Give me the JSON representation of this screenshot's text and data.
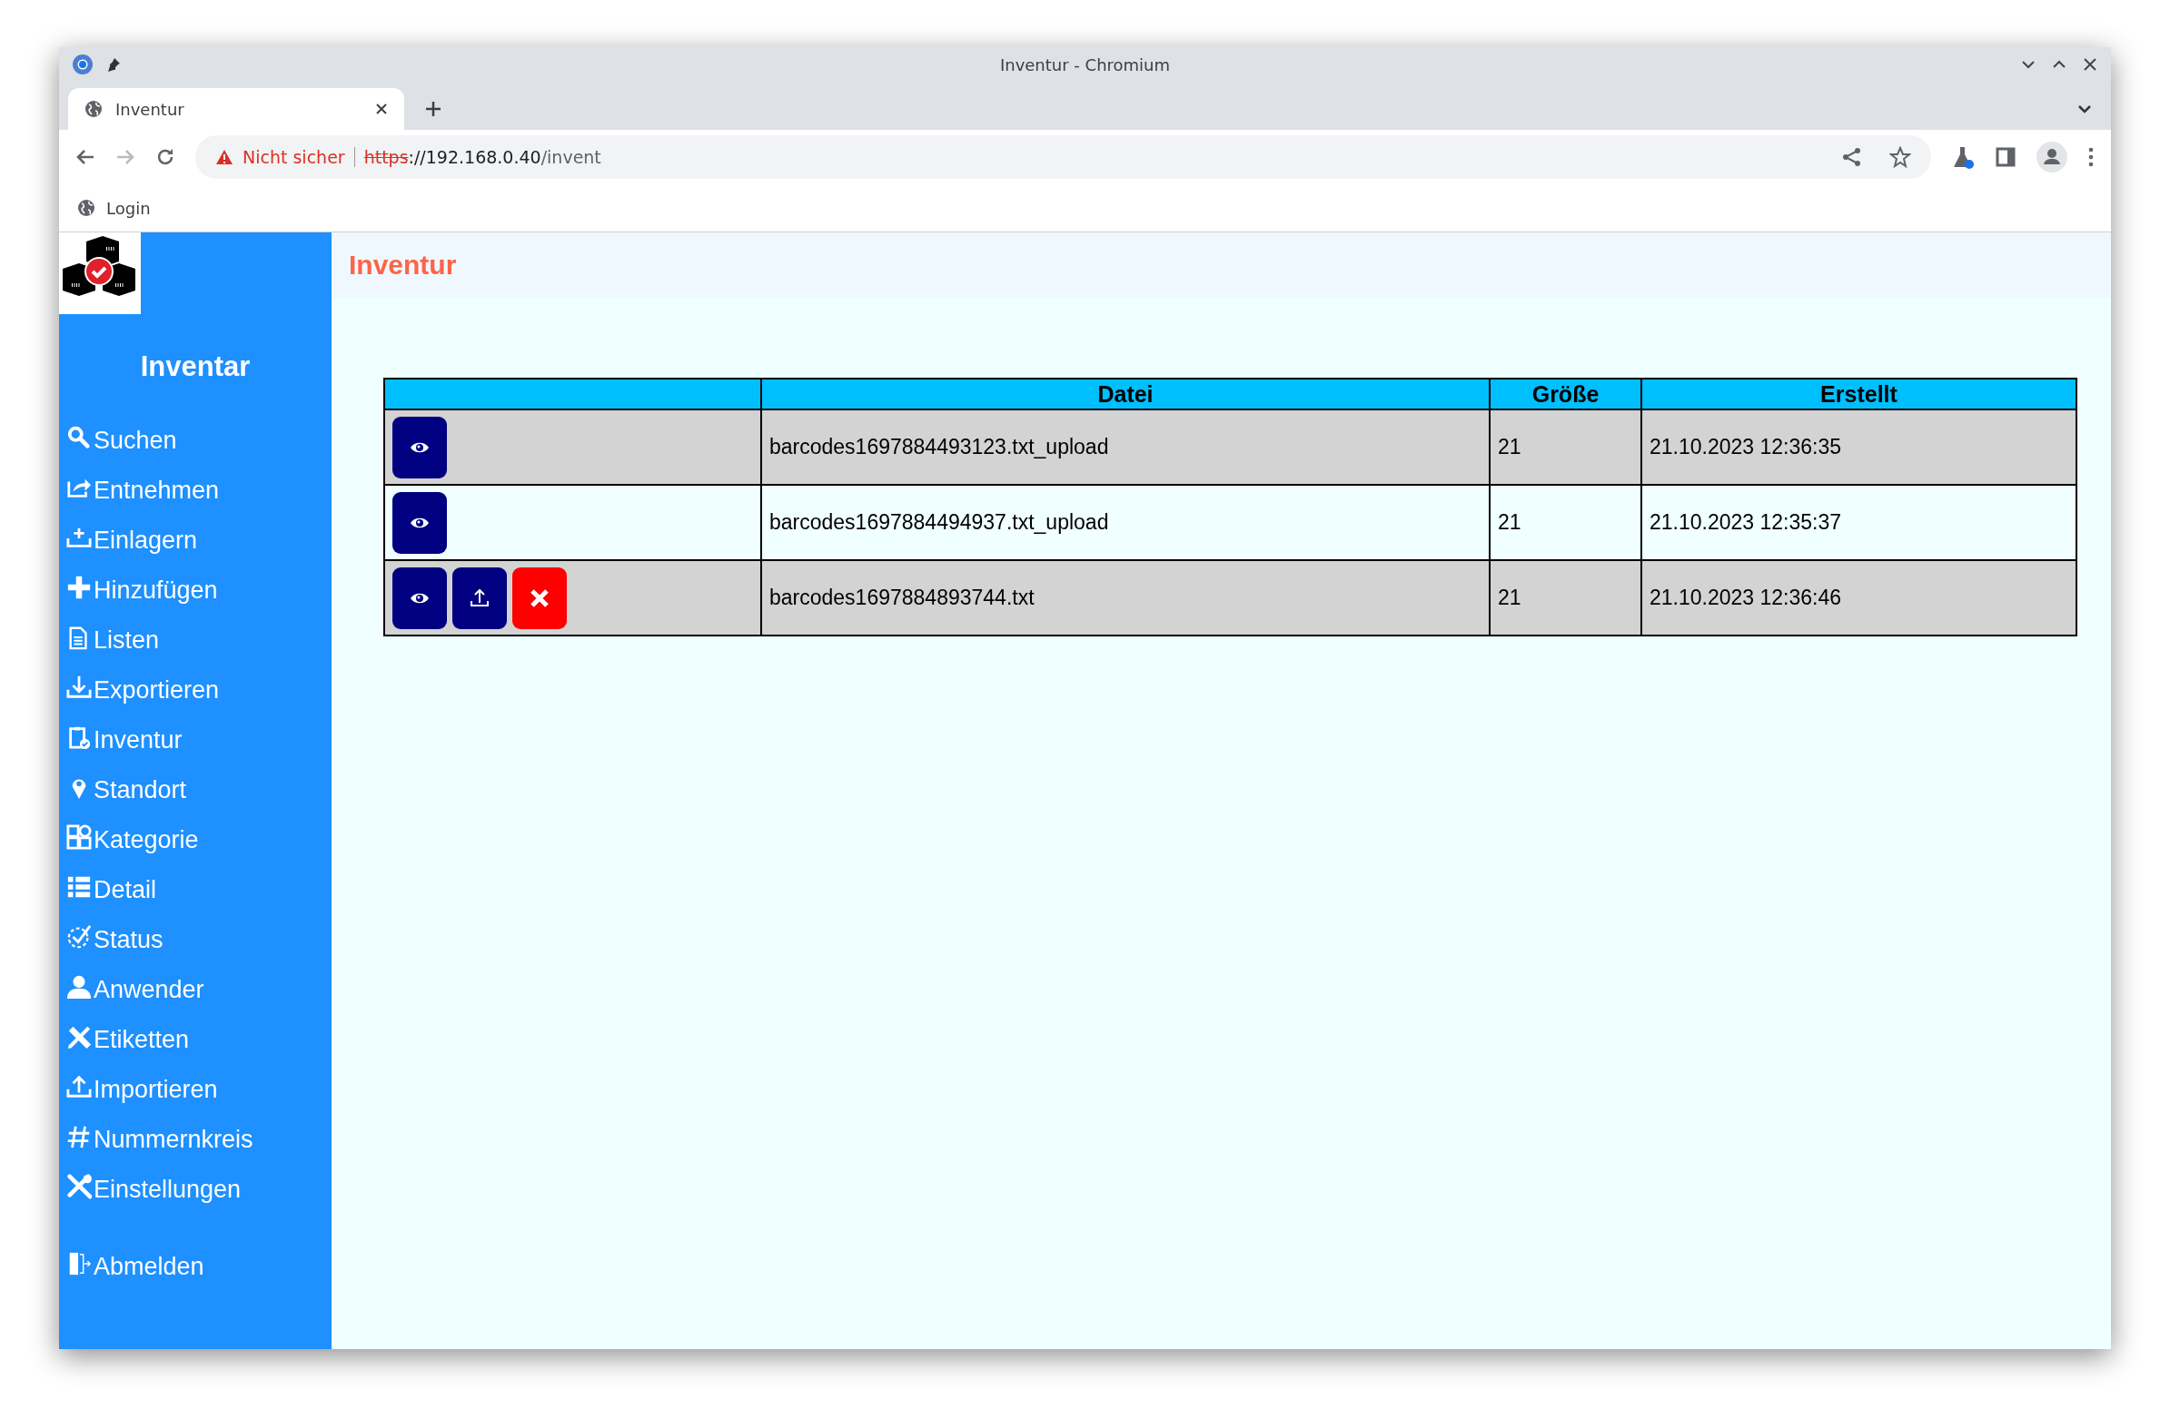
{
  "window": {
    "title": "Inventur - Chromium"
  },
  "tabs": [
    {
      "label": "Inventur",
      "selected": true
    }
  ],
  "address_bar": {
    "security": "Nicht sicher",
    "scheme": "https",
    "host": "://192.168.0.40",
    "path": "/invent"
  },
  "bookmarks": [
    "Login"
  ],
  "sidebar": {
    "title": "Inventar",
    "items": [
      "Suchen",
      "Entnehmen",
      "Einlagern",
      "Hinzufügen",
      "Listen",
      "Exportieren",
      "Inventur",
      "Standort",
      "Kategorie",
      "Detail",
      "Status",
      "Anwender",
      "Etiketten",
      "Importieren",
      "Nummernkreis",
      "Einstellungen"
    ],
    "logout": "Abmelden"
  },
  "page": {
    "title": "Inventur"
  },
  "table": {
    "columns": [
      "",
      "Datei",
      "Größe",
      "Erstellt"
    ],
    "rows": [
      {
        "actions": [
          {
            "kind": "view"
          }
        ],
        "file": "barcodes1697884493123.txt_upload",
        "size": "21",
        "created": "21.10.2023 12:36:35"
      },
      {
        "actions": [
          {
            "kind": "view"
          }
        ],
        "file": "barcodes1697884494937.txt_upload",
        "size": "21",
        "created": "21.10.2023 12:35:37"
      },
      {
        "actions": [
          {
            "kind": "view"
          },
          {
            "kind": "upload"
          },
          {
            "kind": "delete"
          }
        ],
        "file": "barcodes1697884893744.txt",
        "size": "21",
        "created": "21.10.2023 12:36:46"
      }
    ]
  }
}
